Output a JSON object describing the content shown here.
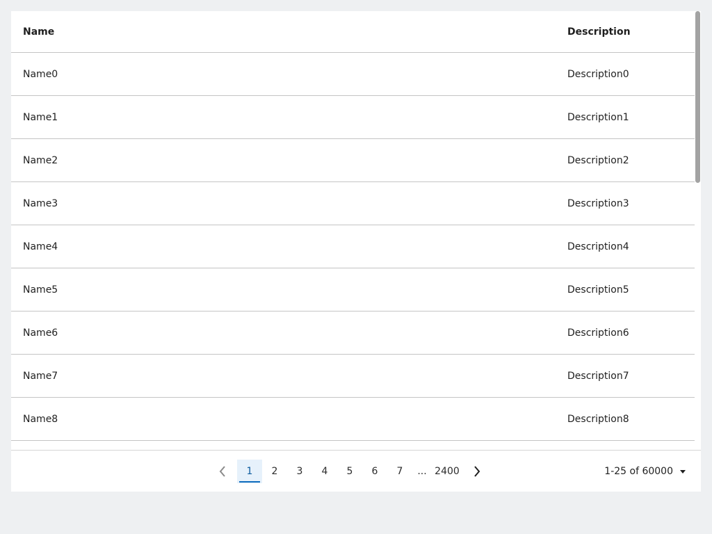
{
  "columns": {
    "name": "Name",
    "description": "Description"
  },
  "rows": [
    {
      "name": "Name0",
      "description": "Description0"
    },
    {
      "name": "Name1",
      "description": "Description1"
    },
    {
      "name": "Name2",
      "description": "Description2"
    },
    {
      "name": "Name3",
      "description": "Description3"
    },
    {
      "name": "Name4",
      "description": "Description4"
    },
    {
      "name": "Name5",
      "description": "Description5"
    },
    {
      "name": "Name6",
      "description": "Description6"
    },
    {
      "name": "Name7",
      "description": "Description7"
    },
    {
      "name": "Name8",
      "description": "Description8"
    }
  ],
  "pagination": {
    "pages": [
      "1",
      "2",
      "3",
      "4",
      "5",
      "6",
      "7"
    ],
    "ellipsis": "...",
    "last_page": "2400",
    "current_page": "1",
    "range_label": "1-25 of 60000"
  },
  "icons": {
    "prev": "chevron-left-icon",
    "next": "chevron-right-icon",
    "dropdown": "caret-down-icon"
  },
  "colors": {
    "accent": "#0f6cbd",
    "active_page_bg": "#e6f1fb",
    "background": "#eef0f2"
  }
}
